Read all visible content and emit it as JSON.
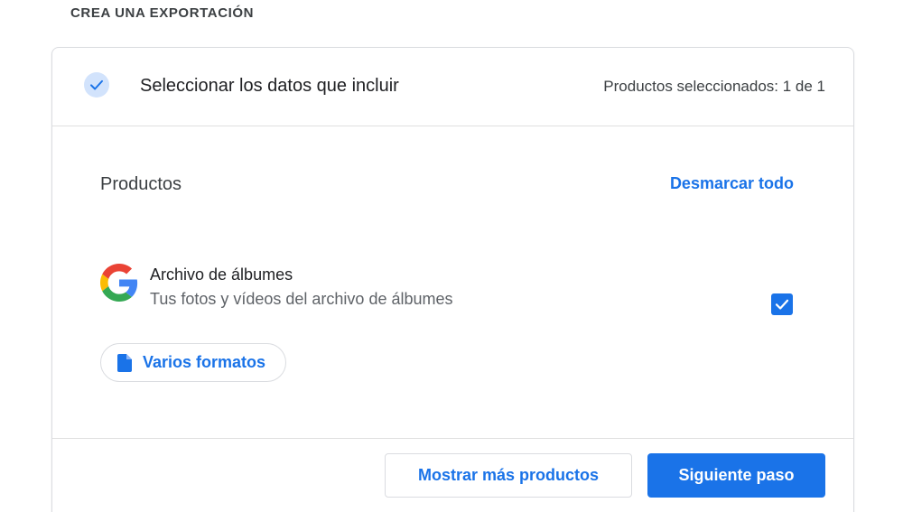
{
  "section_heading": "CREA UNA EXPORTACIÓN",
  "step": {
    "title": "Seleccionar los datos que incluir",
    "status": "Productos seleccionados: 1 de 1",
    "icon": "check-icon",
    "completed": true
  },
  "products": {
    "label": "Productos",
    "deselect_all": "Desmarcar todo",
    "items": [
      {
        "name": "Archivo de álbumes",
        "description": "Tus fotos y vídeos del archivo de álbumes",
        "icon": "google-logo-icon",
        "checked": true,
        "format_label": "Varios formatos",
        "format_icon": "file-icon"
      }
    ]
  },
  "footer": {
    "show_more": "Mostrar más productos",
    "next_step": "Siguiente paso"
  },
  "colors": {
    "accent": "#1a73e8",
    "step_check_bg": "#d2e3fc",
    "border": "#dadce0"
  }
}
